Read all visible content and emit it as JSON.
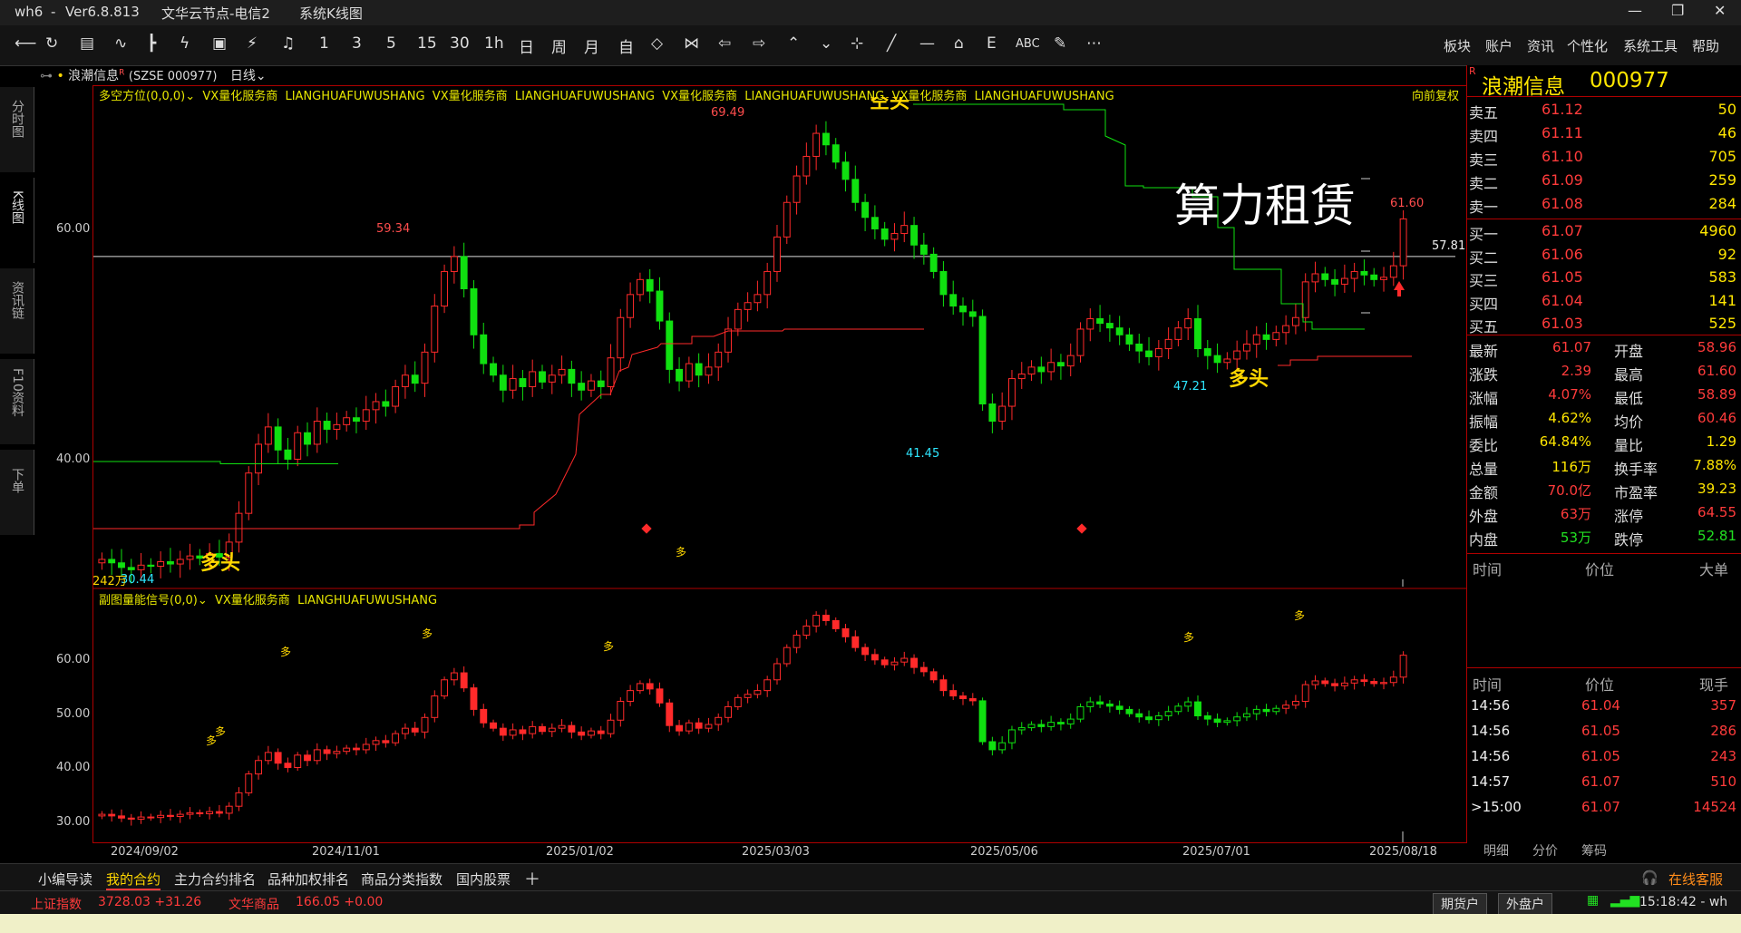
{
  "window": {
    "app": "wh6",
    "version": "Ver6.8.813",
    "node": "文华云节点-电信2",
    "view": "系统K线图"
  },
  "toolbar": {
    "icons": [
      "back-arrow-icon",
      "refresh-icon",
      "list-icon",
      "line-chart-icon",
      "candle-icon",
      "custom-icon",
      "screen-icon",
      "lightning-icon",
      "bell-icon"
    ],
    "periods": [
      "1",
      "3",
      "5",
      "15",
      "30",
      "1h",
      "日",
      "周",
      "月",
      "自"
    ],
    "menus": [
      "板块",
      "账户",
      "资讯",
      "个性化",
      "系统工具",
      "帮助"
    ]
  },
  "left_tabs": [
    "分时图",
    "K线图",
    "资讯链",
    "F10资料",
    "下单"
  ],
  "chart_header": {
    "symbol_label": "浪潮信息",
    "symbol_sup": "R",
    "code": "(SZSE 000977)",
    "period": "日线"
  },
  "main_legend": {
    "indicator": "多空方位(0,0,0)",
    "ads": [
      "VX量化服务商",
      "LIANGHUAFUWUSHANG",
      "VX量化服务商",
      "LIANGHUAFUWUSHANG",
      "VX量化服务商",
      "LIANGHUAFUWUSHANG",
      "VX量化服务商",
      "LIANGHUAFUWUSHANG"
    ],
    "adjust": "向前复权"
  },
  "sub_legend": {
    "indicator": "副图量能信号(0,0)",
    "ads": [
      "VX量化服务商",
      "LIANGHUAFUWUSHANG"
    ]
  },
  "annotations": {
    "overlay_text": "算力租赁",
    "high": "69.49",
    "peak1": "59.34",
    "low1": "41.45",
    "low2": "47.21",
    "last_high": "61.60",
    "ref_line": "57.81",
    "start_low": "30.44",
    "start_vol": "242万",
    "bull1": "多头",
    "bull2": "多头",
    "bear": "空头",
    "sig": "多"
  },
  "chart_data": {
    "type": "candlestick",
    "main_yticks": [
      "60.00",
      "40.00"
    ],
    "sub_yticks": [
      "60.00",
      "50.00",
      "40.00",
      "30.00"
    ],
    "x_ticks": [
      "2024/09/02",
      "2024/11/01",
      "2025/01/02",
      "2025/03/03",
      "2025/05/06",
      "2025/07/01",
      "2025/08/18"
    ],
    "close_series": [
      31.5,
      31.2,
      30.8,
      30.6,
      31.0,
      30.9,
      31.3,
      31.1,
      31.5,
      31.8,
      31.6,
      32.0,
      31.7,
      33.0,
      35.5,
      39.0,
      41.5,
      43.0,
      41.0,
      40.2,
      42.5,
      41.5,
      43.5,
      42.8,
      43.2,
      43.8,
      43.5,
      44.5,
      45.2,
      44.8,
      46.5,
      47.5,
      46.8,
      49.5,
      53.5,
      56.5,
      57.8,
      55.0,
      51.0,
      48.5,
      47.5,
      46.2,
      47.2,
      46.5,
      47.8,
      46.9,
      47.5,
      48.0,
      46.8,
      46.2,
      47.0,
      46.5,
      49.0,
      52.5,
      54.5,
      55.8,
      54.8,
      52.2,
      48.0,
      47.0,
      48.5,
      47.5,
      48.2,
      49.5,
      51.5,
      53.2,
      53.8,
      54.5,
      56.5,
      59.5,
      62.5,
      64.8,
      66.5,
      68.5,
      67.5,
      66.0,
      64.5,
      62.5,
      61.2,
      60.2,
      59.3,
      59.8,
      60.5,
      58.8,
      58.0,
      56.5,
      54.5,
      53.5,
      53.0,
      52.6,
      45.0,
      43.5,
      44.8,
      47.2,
      47.6,
      48.2,
      47.8,
      48.6,
      48.3,
      49.2,
      51.5,
      52.4,
      52.0,
      51.6,
      51.0,
      50.2,
      49.6,
      49.1,
      49.8,
      50.6,
      51.6,
      52.4,
      49.8,
      49.2,
      48.6,
      48.9,
      49.6,
      50.2,
      51.0,
      50.6,
      51.2,
      51.8,
      52.5,
      55.6,
      56.3,
      55.8,
      55.4,
      55.9,
      56.5,
      56.2,
      55.8,
      56.0,
      57.0,
      61.07
    ],
    "bull_line_label": "多头",
    "bear_line_label": "空头"
  },
  "quote": {
    "name": "浪潮信息",
    "code": "000977",
    "badge": "R",
    "asks": [
      {
        "label": "卖五",
        "price": "61.12",
        "vol": "50"
      },
      {
        "label": "卖四",
        "price": "61.11",
        "vol": "46"
      },
      {
        "label": "卖三",
        "price": "61.10",
        "vol": "705"
      },
      {
        "label": "卖二",
        "price": "61.09",
        "vol": "259"
      },
      {
        "label": "卖一",
        "price": "61.08",
        "vol": "284"
      }
    ],
    "bids": [
      {
        "label": "买一",
        "price": "61.07",
        "vol": "4960"
      },
      {
        "label": "买二",
        "price": "61.06",
        "vol": "92"
      },
      {
        "label": "买三",
        "price": "61.05",
        "vol": "583"
      },
      {
        "label": "买四",
        "price": "61.04",
        "vol": "141"
      },
      {
        "label": "买五",
        "price": "61.03",
        "vol": "525"
      }
    ],
    "stats": [
      {
        "l1": "最新",
        "v1": "61.07",
        "c1": "red",
        "l2": "开盘",
        "v2": "58.96",
        "c2": "red"
      },
      {
        "l1": "涨跌",
        "v1": "2.39",
        "c1": "red",
        "l2": "最高",
        "v2": "61.60",
        "c2": "red"
      },
      {
        "l1": "涨幅",
        "v1": "4.07%",
        "c1": "red",
        "l2": "最低",
        "v2": "58.89",
        "c2": "red"
      },
      {
        "l1": "振幅",
        "v1": "4.62%",
        "c1": "yel",
        "l2": "均价",
        "v2": "60.46",
        "c2": "red"
      },
      {
        "l1": "委比",
        "v1": "64.84%",
        "c1": "yel",
        "l2": "量比",
        "v2": "1.29",
        "c2": "yel"
      },
      {
        "l1": "总量",
        "v1": "116万",
        "c1": "yel",
        "l2": "换手率",
        "v2": "7.88%",
        "c2": "yel"
      },
      {
        "l1": "金额",
        "v1": "70.0亿",
        "c1": "red",
        "l2": "市盈率",
        "v2": "39.23",
        "c2": "yel"
      },
      {
        "l1": "外盘",
        "v1": "63万",
        "c1": "red",
        "l2": "涨停",
        "v2": "64.55",
        "c2": "red"
      },
      {
        "l1": "内盘",
        "v1": "53万",
        "c1": "grn",
        "l2": "跌停",
        "v2": "52.81",
        "c2": "grn"
      }
    ],
    "trade_header1": [
      "时间",
      "价位",
      "大单"
    ],
    "trade_header2": [
      "时间",
      "价位",
      "现手"
    ],
    "ticks": [
      {
        "time": "14:56",
        "price": "61.04",
        "vol": "357"
      },
      {
        "time": "14:56",
        "price": "61.05",
        "vol": "286"
      },
      {
        "time": "14:56",
        "price": "61.05",
        "vol": "243"
      },
      {
        "time": "14:57",
        "price": "61.07",
        "vol": "510"
      },
      {
        "time": ">15:00",
        "price": "61.07",
        "vol": "14524"
      }
    ],
    "bottom_tabs": [
      "明细",
      "分价",
      "筹码"
    ]
  },
  "bottom_tabs": [
    "小编导读",
    "我的合约",
    "主力合约排名",
    "品种加权排名",
    "商品分类指数",
    "国内股票"
  ],
  "service": "在线客服",
  "status": {
    "index1_name": "上证指数",
    "index1_value": "3728.03 +31.26",
    "index2_name": "文华商品",
    "index2_value": "166.05 +0.00",
    "btn1": "期货户",
    "btn2": "外盘户",
    "time": "15:18:42 - wh"
  }
}
